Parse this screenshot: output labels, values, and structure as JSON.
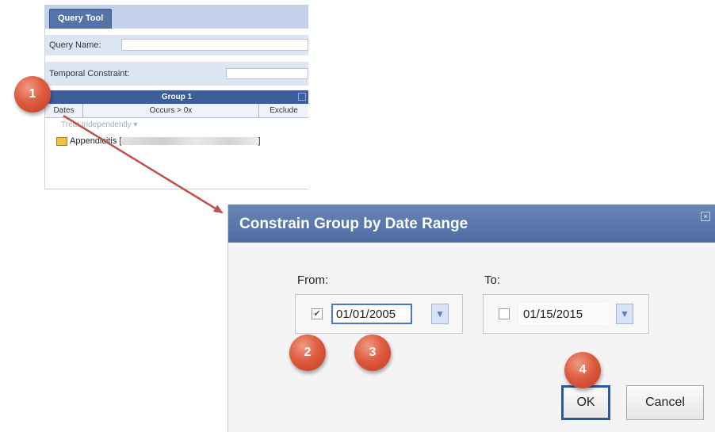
{
  "query_tool": {
    "tab_label": "Query Tool",
    "query_name_label": "Query Name:",
    "temporal_constraint_label": "Temporal Constraint:",
    "group_title": "Group 1",
    "columns": [
      "Dates",
      "Occurs > 0x",
      "Exclude"
    ],
    "group_mode": "Treat Independently",
    "item_label": "Appendicitis [",
    "item_suffix": "]"
  },
  "dialog": {
    "title": "Constrain Group by Date Range",
    "from_label": "From:",
    "to_label": "To:",
    "from_checked": true,
    "from_date": "01/01/2005",
    "to_checked": false,
    "to_date": "01/15/2015",
    "ok_label": "OK",
    "cancel_label": "Cancel",
    "close_icon": "close-icon",
    "calendar_icon": "calendar-dropdown-icon"
  },
  "callouts": [
    "1",
    "2",
    "3",
    "4"
  ],
  "colors": {
    "callout": "#d9502f",
    "title_bar": "#5b78ad",
    "arrow": "#c0504d",
    "focus_border": "#2b57a5"
  }
}
